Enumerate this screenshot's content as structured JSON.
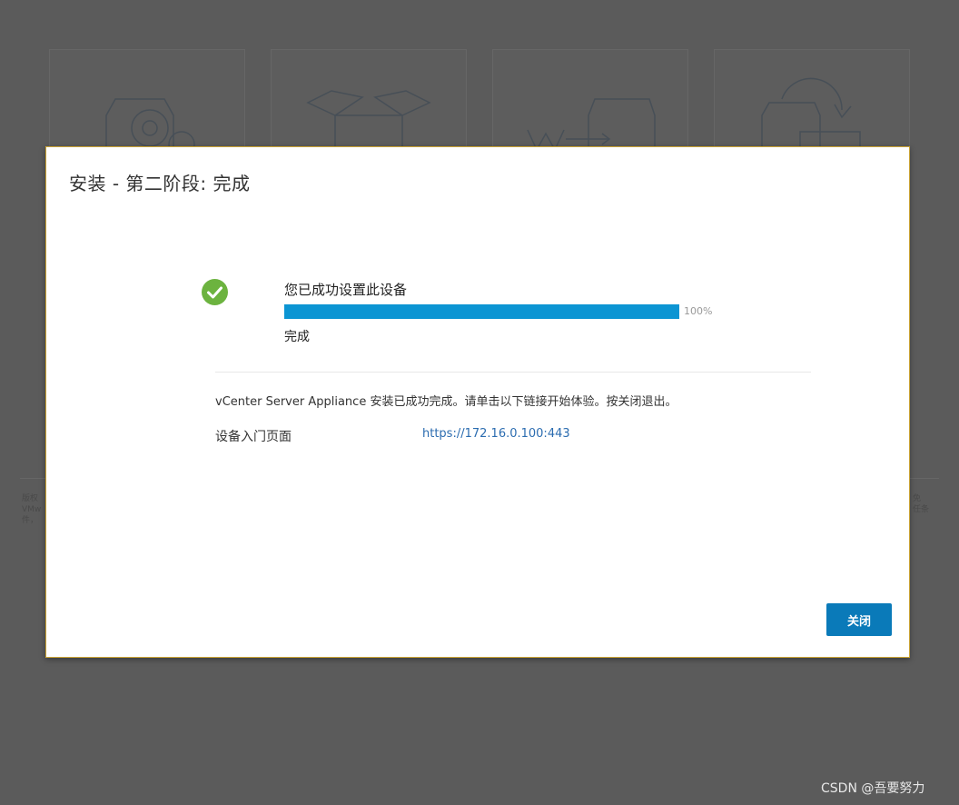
{
  "dialog": {
    "title": "安装 - 第二阶段: 完成",
    "status_title": "您已成功设置此设备",
    "progress_percent_label": "100%",
    "progress_value": 1.0,
    "status_subtitle": "完成",
    "message": "vCenter Server Appliance 安装已成功完成。请单击以下链接开始体验。按关闭退出。",
    "portal_label": "设备入门页面",
    "portal_link": "https://172.16.0.100:443",
    "close_button": "关闭"
  },
  "icons": {
    "status": "check-circle-icon"
  },
  "colors": {
    "accent": "#0c95d3",
    "button": "#0a7ab9",
    "success": "#6cb33f",
    "link": "#2b6cb0"
  },
  "watermark": "CSDN @吾要努力"
}
